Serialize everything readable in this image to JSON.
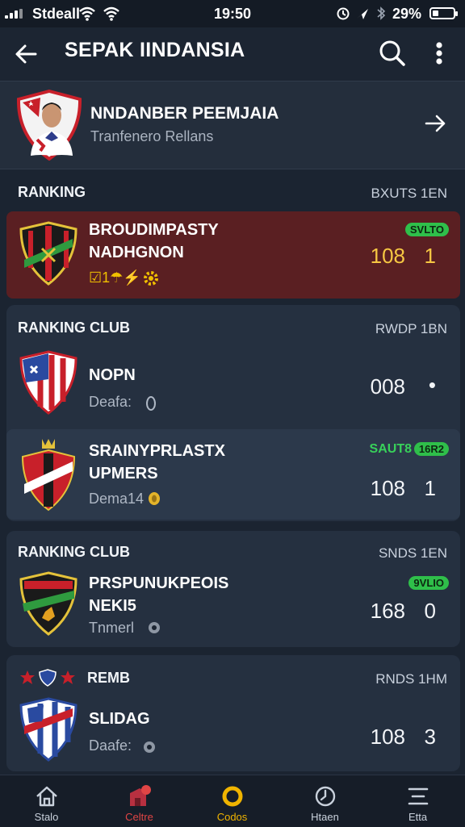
{
  "status": {
    "carrier": "Stdeall",
    "time": "19:50",
    "battery": "29%",
    "battery_level": 0.29
  },
  "header": {
    "title": "SEPAK IINDANSIA"
  },
  "featured": {
    "name": "NNDANBER PEEMJAIA",
    "subtitle": "Tranfenero Rellans"
  },
  "sections": [
    {
      "title": "RANKING",
      "meta": "BXUTS 1EN",
      "rows": [
        {
          "line1": "BROUDIMPASTY",
          "line2": "NADHGNON",
          "line3": "☑1☂⚡",
          "points": "108",
          "rank": "1",
          "pill": "SVLTO",
          "highlight": "#5a1f22"
        }
      ]
    },
    {
      "title": "RANKING CLUB",
      "meta": "RWDP 1BN",
      "rows": [
        {
          "line1": "NOPN",
          "line3": "Deafa:",
          "points": "008",
          "rank": "•"
        },
        {
          "line1": "SRAINYPRLASTX",
          "line2": "UPMERS",
          "line3": "Dema14",
          "points": "108",
          "rank": "1",
          "tag": "SAUT8",
          "pill": "16R2"
        }
      ]
    },
    {
      "title": "RANKING CLUB",
      "meta": "SNDS 1EN",
      "rows": [
        {
          "line1": "PRSPUNUKPEOIS",
          "line2": "NEKI5",
          "line3": "Tnmerl",
          "points": "168",
          "rank": "0",
          "pill": "9VLIO"
        }
      ]
    },
    {
      "title": "REMB",
      "meta": "RNDS 1HM",
      "rows": [
        {
          "line1": "SLIDAG",
          "line3": "Daafe:",
          "points": "108",
          "rank": "3"
        }
      ]
    }
  ],
  "nav": [
    {
      "label": "Stalo",
      "icon": "home-icon",
      "color": "#c9d1dc"
    },
    {
      "label": "Celtre",
      "icon": "shop-icon",
      "color": "#e04545"
    },
    {
      "label": "Codos",
      "icon": "ring-icon",
      "color": "#f0b400"
    },
    {
      "label": "Htaen",
      "icon": "clock-icon",
      "color": "#c9d1dc"
    },
    {
      "label": "Etta",
      "icon": "menu-icon",
      "color": "#c9d1dc"
    }
  ]
}
